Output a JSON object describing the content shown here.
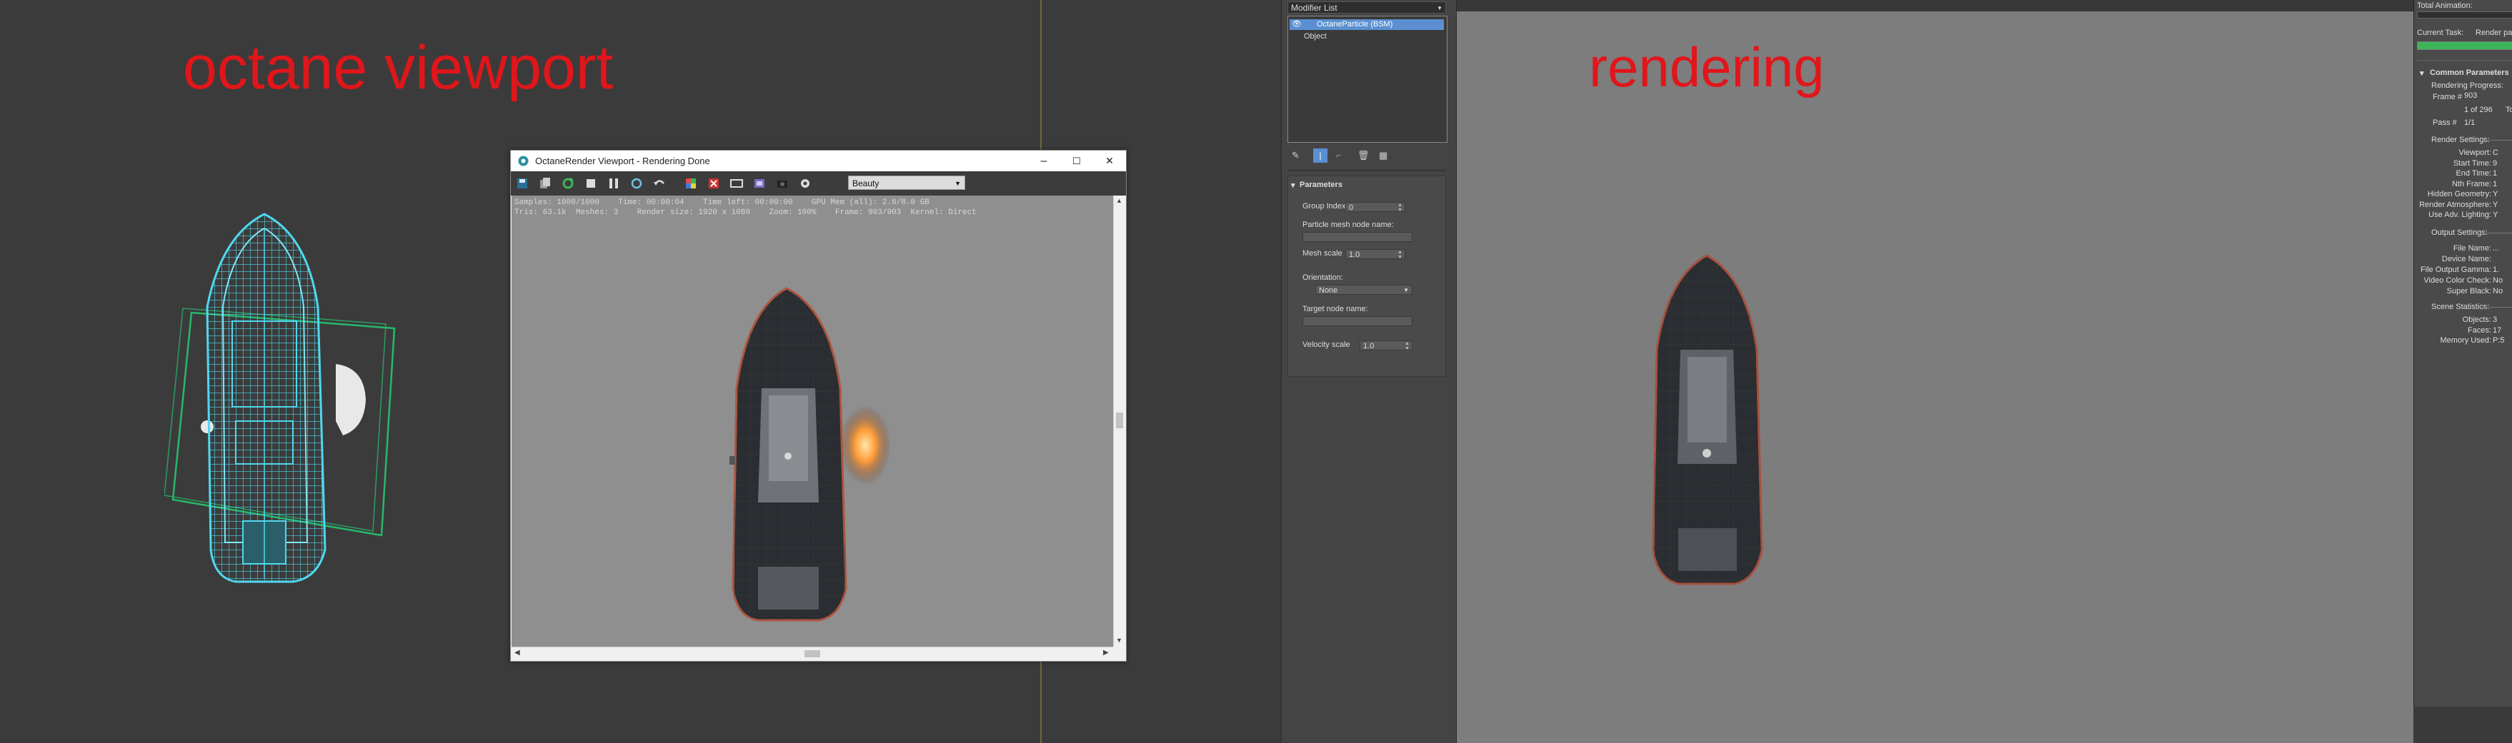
{
  "annotations": {
    "left_label": "octane viewport",
    "right_label": "rendering"
  },
  "colors": {
    "annotation_red": "#e0161b",
    "viewport_bg": "#3b3b3b",
    "wireframe_cyan": "#4fd8ef",
    "bbox_green": "#27b86b",
    "selection_blue": "#5b8fd1",
    "progress_green": "#3cb55a"
  },
  "octane_window": {
    "title": "OctaneRender Viewport - Rendering Done",
    "controls": {
      "minimize": "–",
      "maximize": "☐",
      "close": "✕"
    },
    "render_mode": "Beauty",
    "stats_line1": "Samples: 1000/1000    Time: 00:00:04    Time left: 00:00:00    GPU Mem (all): 2.6/8.0 GB",
    "stats_line2": "Tris: 63.1k  Meshes: 3    Render size: 1920 x 1080    Zoom: 100%    Frame: 903/903  Kernel: Direct"
  },
  "modifier_panel": {
    "list_label": "Modifier List",
    "stack_items": [
      "OctaneParticle (BSM)",
      "Object"
    ],
    "rollout_title": "Parameters",
    "group_index_label": "Group Index",
    "group_index_value": "0",
    "particle_mesh_label": "Particle mesh node name:",
    "mesh_scale_label": "Mesh scale",
    "mesh_scale_value": "1.0",
    "orientation_label": "Orientation:",
    "orientation_value": "None",
    "target_node_label": "Target node name:",
    "velocity_scale_label": "Velocity scale",
    "velocity_scale_value": "1.0"
  },
  "render_panel": {
    "total_animation_label": "Total Animation:",
    "current_task_label": "Current Task:",
    "current_task_value": "Render pass",
    "common_params_title": "Common Parameters",
    "rendering_progress_label": "Rendering Progress:",
    "frame_label": "Frame #",
    "frame_value": "903",
    "frame_count": "1 of 296",
    "frame_total_label": "To",
    "pass_label": "Pass #",
    "pass_value": "1/1",
    "render_settings_label": "Render Settings:",
    "render_settings": [
      {
        "label": "Viewport:",
        "value": "C"
      },
      {
        "label": "Start Time:",
        "value": "9"
      },
      {
        "label": "End Time:",
        "value": "1"
      },
      {
        "label": "Nth Frame:",
        "value": "1"
      },
      {
        "label": "Hidden Geometry:",
        "value": "Y"
      },
      {
        "label": "Render Atmosphere:",
        "value": "Y"
      },
      {
        "label": "Use Adv. Lighting:",
        "value": "Y"
      }
    ],
    "output_settings_label": "Output Settings:",
    "output_settings": [
      {
        "label": "File Name:",
        "value": "..."
      },
      {
        "label": "Device Name:",
        "value": ""
      },
      {
        "label": "File Output Gamma:",
        "value": "1."
      },
      {
        "label": "Video Color Check:",
        "value": "No"
      },
      {
        "label": "Super Black:",
        "value": "No"
      }
    ],
    "scene_statistics_label": "Scene Statistics:",
    "scene_statistics": [
      {
        "label": "Objects:",
        "value": "3"
      },
      {
        "label": "Faces:",
        "value": "17"
      },
      {
        "label": "Memory Used:",
        "value": "P:5"
      }
    ]
  }
}
